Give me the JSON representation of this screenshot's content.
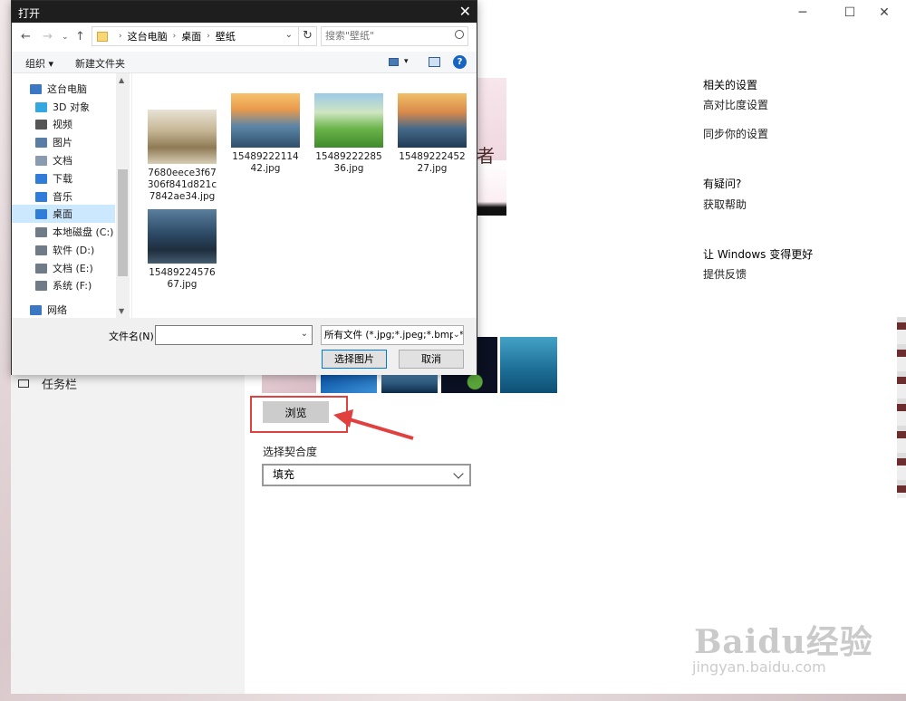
{
  "dialog": {
    "title": "打开",
    "close_glyph": "✕",
    "breadcrumb": [
      "这台电脑",
      "桌面",
      "壁纸"
    ],
    "search_placeholder": "搜索\"壁纸\"",
    "toolbar": {
      "organize": "组织 ▾",
      "new_folder": "新建文件夹"
    },
    "nav_items": [
      {
        "label": "这台电脑",
        "icon": "computer-icon",
        "color": "#3b78c4"
      },
      {
        "label": "3D 对象",
        "icon": "cube-icon",
        "color": "#35a7e0"
      },
      {
        "label": "视频",
        "icon": "video-icon",
        "color": "#555555"
      },
      {
        "label": "图片",
        "icon": "picture-icon",
        "color": "#5a7da6"
      },
      {
        "label": "文档",
        "icon": "document-icon",
        "color": "#8a9bb0"
      },
      {
        "label": "下载",
        "icon": "download-icon",
        "color": "#2f7dd8"
      },
      {
        "label": "音乐",
        "icon": "music-icon",
        "color": "#2f7dd8"
      },
      {
        "label": "桌面",
        "icon": "desktop-icon",
        "color": "#2f7dd8",
        "selected": true
      },
      {
        "label": "本地磁盘 (C:)",
        "icon": "drive-icon",
        "color": "#6f7b86"
      },
      {
        "label": "软件 (D:)",
        "icon": "drive-icon",
        "color": "#6f7b86"
      },
      {
        "label": "文档 (E:)",
        "icon": "drive-icon",
        "color": "#6f7b86"
      },
      {
        "label": "系统 (F:)",
        "icon": "drive-icon",
        "color": "#6f7b86"
      },
      {
        "label": "网络",
        "icon": "network-icon",
        "color": "#3b78c4"
      }
    ],
    "files": [
      {
        "name": "7680eece3f67306f841d821c7842ae34.jpg"
      },
      {
        "name": "1548922211442.jpg"
      },
      {
        "name": "1548922228536.jpg"
      },
      {
        "name": "1548922245227.jpg"
      },
      {
        "name": "1548922457667.jpg"
      }
    ],
    "filename_label": "文件名(N):",
    "filename_value": "",
    "filter": "所有文件 (*.jpg;*.jpeg;*.bmp;*.",
    "open_button": "选择图片",
    "cancel_button": "取消"
  },
  "settings": {
    "taskbar_label": "任务栏",
    "browse_button": "浏览",
    "fit_label": "选择契合度",
    "fit_value": "填充",
    "related_title": "相关的设置",
    "high_contrast": "高对比度设置",
    "sync": "同步你的设置",
    "question_title": "有疑问?",
    "get_help": "获取帮助",
    "better_title": "让 Windows 变得更好",
    "feedback": "提供反馈",
    "preview_char": "者"
  },
  "watermark": {
    "logo": "Baidu经验",
    "url": "jingyan.baidu.com"
  },
  "colors": {
    "highlight_red": "#e0413e",
    "accent_blue": "#0078d7"
  }
}
